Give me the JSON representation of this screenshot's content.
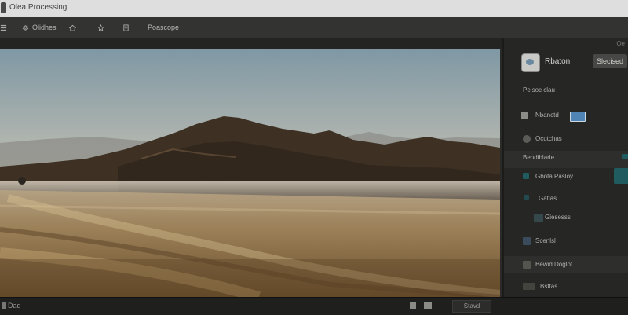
{
  "window": {
    "title": "Olea Processing"
  },
  "toolbar": {
    "items": [
      {
        "icon": "menu-icon",
        "label": ""
      },
      {
        "icon": "layers-icon",
        "label": "Olidhes"
      },
      {
        "icon": "home-icon",
        "label": ""
      },
      {
        "icon": "star-icon",
        "label": ""
      },
      {
        "icon": "document-icon",
        "label": ""
      },
      {
        "icon": "",
        "label": "Poascope"
      }
    ]
  },
  "panel": {
    "corner_label": "Oe",
    "header": {
      "title": "Rbaton",
      "button": "Slecised"
    },
    "subtitle": "Pelsoc clau",
    "items": [
      {
        "label": "Nbanctd",
        "icon": "image-icon"
      },
      {
        "label": "Ocutchas",
        "icon": "globe-icon"
      },
      {
        "label": "Bendiblarle"
      },
      {
        "label": "Gbota Pasloy"
      },
      {
        "label": "Gatlas"
      },
      {
        "label": "Giesesss"
      },
      {
        "label": "Scenlsl"
      },
      {
        "label": "Bewid Doglot"
      },
      {
        "label": "Bsttas"
      }
    ]
  },
  "status": {
    "left": "Dad",
    "button": "Stavd"
  },
  "colors": {
    "accent": "#1f5b5f",
    "panel_bg": "#262625",
    "toolbar_bg": "#333331"
  }
}
